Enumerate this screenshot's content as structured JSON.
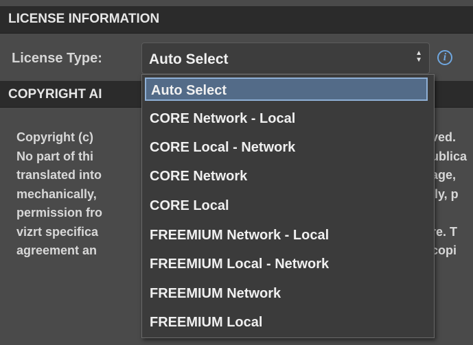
{
  "sections": {
    "license_header": "LICENSE INFORMATION",
    "copyright_header": "COPYRIGHT AI"
  },
  "license": {
    "label": "License Type:",
    "selected_value": "Auto Select",
    "info_icon": "info-icon"
  },
  "dropdown": {
    "options": [
      "Auto Select",
      "CORE Network - Local",
      "CORE Local - Network",
      "CORE Network",
      "CORE Local",
      "FREEMIUM Network - Local",
      "FREEMIUM Local - Network",
      "FREEMIUM Network",
      "FREEMIUM Local"
    ]
  },
  "copyright_text": {
    "left": [
      "Copyright (c)",
      "No part of thi",
      "translated into",
      "mechanically,",
      "permission fro",
      "vizrt specifica",
      "agreement an"
    ],
    "right": [
      "ved.",
      "ublica",
      "age,",
      "lly, p",
      "",
      "re. T",
      "copi"
    ]
  },
  "colors": {
    "header_bg": "#2b2b2b",
    "panel_bg": "#4a4a4a",
    "selected_bg": "#536b88",
    "info_blue": "#6fa7e0"
  }
}
